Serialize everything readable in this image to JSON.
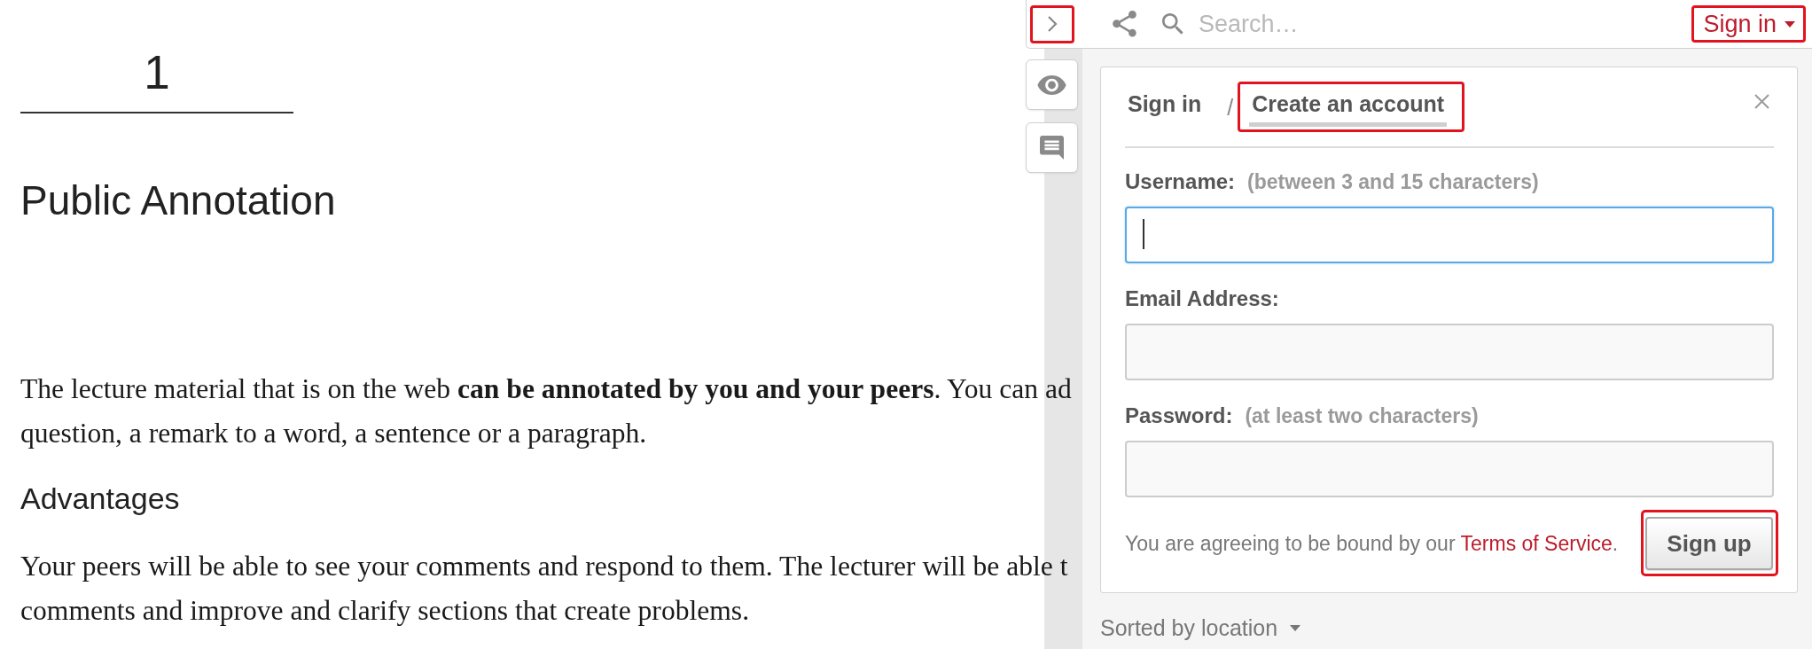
{
  "page": {
    "number": "1",
    "title": "Public Annotation",
    "sections": [
      {
        "kind": "paragraph",
        "lines": [
          "The lecture material that is on the web **can be annotated by you and your peers**. You can ad",
          "question, a remark to a word, a sentence or a paragraph."
        ]
      },
      {
        "kind": "heading",
        "text": "Advantages"
      },
      {
        "kind": "paragraph",
        "lines": [
          "Your peers will be able to see your comments and respond to them. The lecturer will be able t",
          "comments and improve and clarify sections that create problems."
        ]
      }
    ]
  },
  "sidebar": {
    "toolbar": {
      "collapse_button": {
        "highlighted": true
      },
      "search": {
        "placeholder": "Search…"
      },
      "account_menu": {
        "label": "Sign in",
        "highlighted": true
      }
    },
    "bucket_buttons": [
      {
        "kind": "eye"
      },
      {
        "kind": "speech_bubble"
      }
    ],
    "auth_card": {
      "tabs": [
        {
          "label": "Sign in",
          "selected": false,
          "highlighted": false
        },
        {
          "label": "Create an account",
          "selected": true,
          "highlighted": true
        }
      ],
      "separator": "/",
      "fields": [
        {
          "label": "Username:",
          "hint": "(between 3 and 15 characters)",
          "focused": true
        },
        {
          "label": "Email Address:",
          "focused": false
        },
        {
          "label": "Password:",
          "hint": "(at least two characters)",
          "focused": false
        }
      ],
      "agreement": {
        "text": "You are agreeing to be bound by our ",
        "link": "Terms of Service",
        "end": "."
      },
      "submit": {
        "label": "Sign up",
        "highlighted": true
      }
    },
    "sort_menu": {
      "label": "Sorted by location"
    }
  }
}
